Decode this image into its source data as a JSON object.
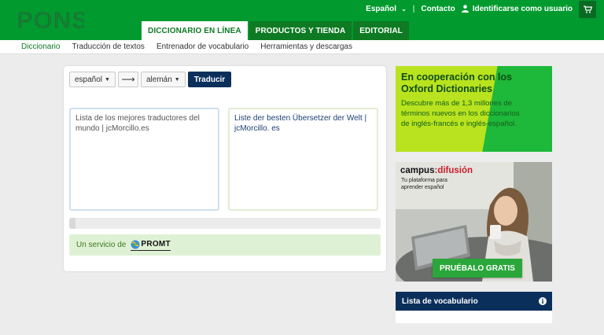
{
  "brand": {
    "logo_text": "PONS"
  },
  "topnav": {
    "language": "Español",
    "contact": "Contacto",
    "login": "Identificarse como usuario",
    "cart_icon": "cart-icon",
    "user_icon": "user-icon"
  },
  "main_tabs": [
    {
      "label": "DICCIONARIO EN LÍNEA",
      "active": true
    },
    {
      "label": "PRODUCTOS Y TIENDA",
      "active": false
    },
    {
      "label": "EDITORIAL",
      "active": false
    }
  ],
  "subnav": [
    {
      "label": "Diccionario",
      "active": true
    },
    {
      "label": "Traducción de textos",
      "active": false
    },
    {
      "label": "Entrenador de vocabulario",
      "active": false
    },
    {
      "label": "Herramientas y descargas",
      "active": false
    }
  ],
  "translator": {
    "source_lang": "español",
    "target_lang": "alemán",
    "swap_icon": "arrow-right-icon",
    "translate_label": "Traducir",
    "source_text": "Lista de los mejores traductores del mundo | jcMorcillo.es",
    "target_text": "Liste der besten Übersetzer der Welt | jcMorcillo. es",
    "progress": 0.02,
    "service_label": "Un servicio de",
    "service_brand": "PROMT"
  },
  "ads": {
    "oxford": {
      "title": "En cooperación con los Oxford Dictionaries",
      "body": "Descubre más de 1,3 millones de términos nuevos en los diccionarios de inglés-francés e inglés-español."
    },
    "campus": {
      "brand_a": "campus",
      "brand_b": "difusión",
      "tagline": "Tu plataforma para aprender español",
      "cta": "PRUÉBALO GRATIS"
    }
  },
  "vocab": {
    "title": "Lista de vocabulario",
    "info_icon": "info-icon"
  },
  "colors": {
    "brand_green": "#009a2e",
    "navy": "#0b2f5b",
    "lime": "#b9e31e"
  }
}
